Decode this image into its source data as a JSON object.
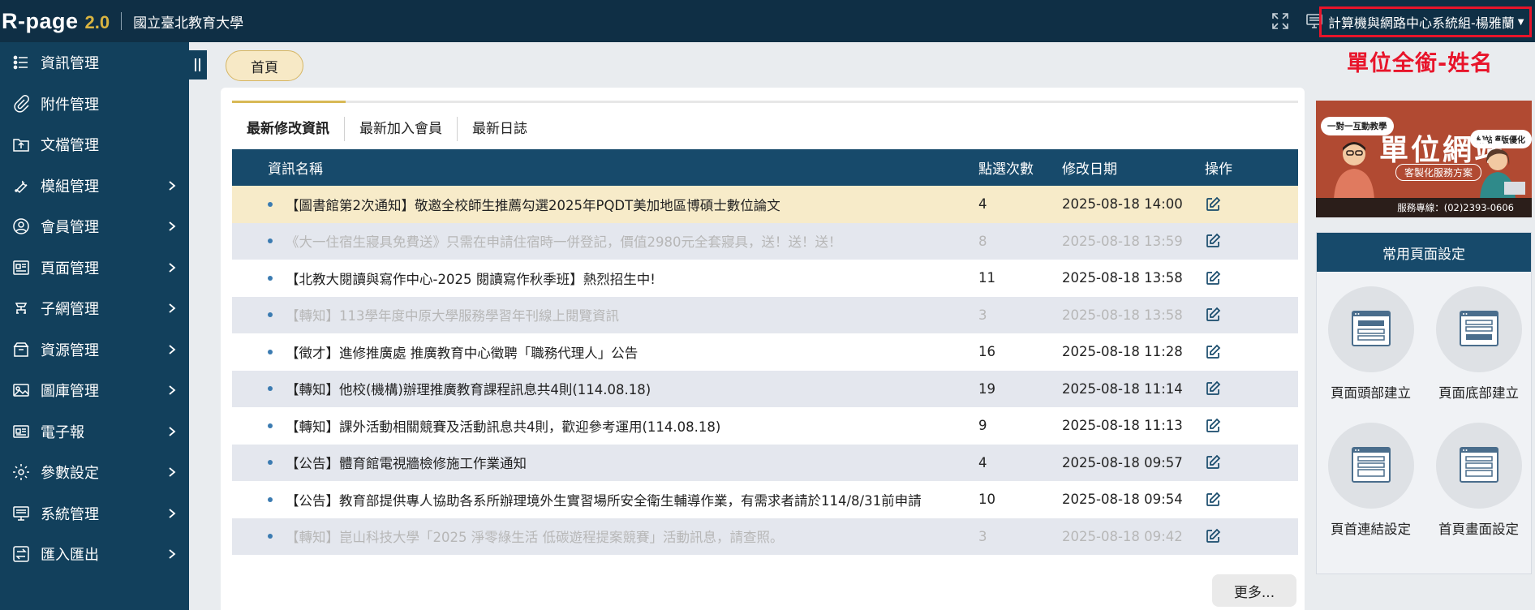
{
  "header": {
    "logo_main": "R-page",
    "logo_version": "2.0",
    "school_name": "國立臺北教育大學",
    "user_name": "計算機與網路中心系統組-楊雅蘭",
    "user_annotation": "單位全銜-姓名"
  },
  "sidebar": {
    "items": [
      {
        "label": "資訊管理",
        "icon": "list-icon",
        "has_submenu": false
      },
      {
        "label": "附件管理",
        "icon": "attachment-icon",
        "has_submenu": false
      },
      {
        "label": "文檔管理",
        "icon": "folder-upload-icon",
        "has_submenu": false
      },
      {
        "label": "模組管理",
        "icon": "wrench-icon",
        "has_submenu": true
      },
      {
        "label": "會員管理",
        "icon": "user-icon",
        "has_submenu": true
      },
      {
        "label": "頁面管理",
        "icon": "page-icon",
        "has_submenu": true
      },
      {
        "label": "子網管理",
        "icon": "network-icon",
        "has_submenu": true
      },
      {
        "label": "資源管理",
        "icon": "box-icon",
        "has_submenu": true
      },
      {
        "label": "圖庫管理",
        "icon": "image-icon",
        "has_submenu": true
      },
      {
        "label": "電子報",
        "icon": "newsletter-icon",
        "has_submenu": true
      },
      {
        "label": "參數設定",
        "icon": "gear-icon",
        "has_submenu": true
      },
      {
        "label": "系統管理",
        "icon": "monitor-icon",
        "has_submenu": true
      },
      {
        "label": "匯入匯出",
        "icon": "import-export-icon",
        "has_submenu": true
      }
    ]
  },
  "breadcrumb": {
    "home": "首頁"
  },
  "tabs": [
    {
      "label": "最新修改資訊",
      "active": true
    },
    {
      "label": "最新加入會員",
      "active": false
    },
    {
      "label": "最新日誌",
      "active": false
    }
  ],
  "table": {
    "headers": {
      "name": "資訊名稱",
      "hits": "點選次數",
      "date": "修改日期",
      "op": "操作"
    },
    "rows": [
      {
        "name": "【圖書館第2次通知】敬邀全校師生推薦勾選2025年PQDT美加地區博碩士數位論文",
        "hits": "4",
        "date": "2025-08-18 14:00",
        "muted": false
      },
      {
        "name": "《大一住宿生寢具免費送》只需在申請住宿時一併登記，價值2980元全套寢具，送！送！送！",
        "hits": "8",
        "date": "2025-08-18 13:59",
        "muted": true
      },
      {
        "name": "【北教大閱讀與寫作中心-2025 閱讀寫作秋季班】熱烈招生中!",
        "hits": "11",
        "date": "2025-08-18 13:58",
        "muted": false
      },
      {
        "name": "【轉知】113學年度中原大學服務學習年刊線上閱覽資訊",
        "hits": "3",
        "date": "2025-08-18 13:58",
        "muted": true
      },
      {
        "name": "【徵才】進修推廣處 推廣教育中心徵聘「職務代理人」公告",
        "hits": "16",
        "date": "2025-08-18 11:28",
        "muted": false
      },
      {
        "name": "【轉知】他校(機構)辦理推廣教育課程訊息共4則(114.08.18)",
        "hits": "19",
        "date": "2025-08-18 11:14",
        "muted": false
      },
      {
        "name": "【轉知】課外活動相關競賽及活動訊息共4則，歡迎參考運用(114.08.18)",
        "hits": "9",
        "date": "2025-08-18 11:13",
        "muted": false
      },
      {
        "name": "【公告】體育館電視牆檢修施工作業通知",
        "hits": "4",
        "date": "2025-08-18 09:57",
        "muted": false
      },
      {
        "name": "【公告】教育部提供專人協助各系所辦理境外生實習場所安全衛生輔導作業，有需求者請於114/8/31前申請",
        "hits": "10",
        "date": "2025-08-18 09:54",
        "muted": false
      },
      {
        "name": "【轉知】崑山科技大學「2025 淨零綠生活 低碳遊程提案競賽」活動訊息，請查照。",
        "hits": "3",
        "date": "2025-08-18 09:42",
        "muted": true
      }
    ],
    "more_label": "更多..."
  },
  "banner": {
    "bubble_left": "一對一互動教學",
    "bubble_right": "網站模版優化",
    "title": "單位網站",
    "subtitle": "客製化服務方案",
    "phone": "服務專線：(02)2393-0606"
  },
  "settings": {
    "title": "常用頁面設定",
    "tiles": [
      {
        "label": "頁面頭部建立",
        "icon": "page-header-icon"
      },
      {
        "label": "頁面底部建立",
        "icon": "page-footer-icon"
      },
      {
        "label": "頁首連結設定",
        "icon": "header-links-icon"
      },
      {
        "label": "首頁畫面設定",
        "icon": "homepage-layout-icon"
      }
    ]
  },
  "colors": {
    "topbar": "#0f2f45",
    "sidebar": "#12405c",
    "table_header": "#174a6b",
    "highlight_row": "#f7ebc9",
    "accent_gold": "#d8b955",
    "annotation_red": "#e8142a"
  }
}
